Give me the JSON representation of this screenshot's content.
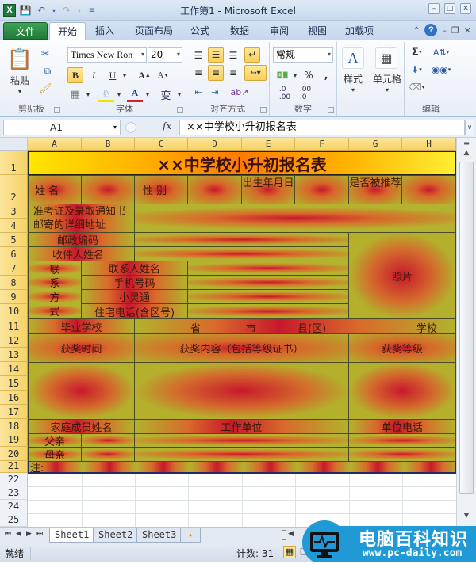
{
  "window": {
    "title": "工作簿1 - Microsoft Excel",
    "controls": [
      "minimize",
      "restore",
      "close"
    ]
  },
  "quick_access": [
    "excel-logo",
    "save",
    "undo",
    "redo",
    "customize"
  ],
  "ribbon_tabs": [
    {
      "label": "文件",
      "type": "file"
    },
    {
      "label": "开始",
      "active": true
    },
    {
      "label": "插入"
    },
    {
      "label": "页面布局"
    },
    {
      "label": "公式"
    },
    {
      "label": "数据"
    },
    {
      "label": "审阅"
    },
    {
      "label": "视图"
    },
    {
      "label": "加载项"
    }
  ],
  "ribbon": {
    "clipboard": {
      "label": "剪贴板",
      "paste": "粘贴"
    },
    "font": {
      "label": "字体",
      "font_name": "Times New Ron",
      "font_size": "20",
      "bold_active": true
    },
    "alignment": {
      "label": "对齐方式"
    },
    "number": {
      "label": "数字",
      "format": "常规",
      "percent": "%",
      "comma": ","
    },
    "styles": {
      "label": "样式"
    },
    "cells": {
      "label": "单元格"
    },
    "editing": {
      "label": "编辑"
    }
  },
  "formula_bar": {
    "name_box": "A1",
    "fx": "fx",
    "content": "××中学校小升初报名表"
  },
  "columns": [
    "A",
    "B",
    "C",
    "D",
    "E",
    "F",
    "G",
    "H"
  ],
  "rows": [
    "1",
    "2",
    "3",
    "4",
    "5",
    "6",
    "7",
    "8",
    "9",
    "10",
    "11",
    "12",
    "13",
    "14",
    "15",
    "16",
    "17",
    "18",
    "19",
    "20",
    "21",
    "22",
    "23",
    "24",
    "25"
  ],
  "form": {
    "title": "××中学校小升初报名表",
    "name_label": "姓  名",
    "gender_label": "性  别",
    "birth_label": "出生年月日",
    "recommend_label": "是否被推荐",
    "address_label": "准考证及录取通知书邮寄的详细地址",
    "postcode_label": "邮政编码",
    "recipient_label": "收件人姓名",
    "contact_group": [
      "联",
      "系",
      "方",
      "式"
    ],
    "contact_name_label": "联系人姓名",
    "mobile_label": "手机号码",
    "phs_label": "小灵通",
    "home_phone_label": "住宅电话(含区号)",
    "photo_label": "照片",
    "school_label": "毕业学校",
    "province": "省",
    "city": "市",
    "county": "县(区)",
    "school_suffix": "学校",
    "award_time_label": "获奖时间",
    "award_content_label": "获奖内容（包括等级证书）",
    "award_level_label": "获奖等级",
    "family_name_label": "家庭成员姓名",
    "work_unit_label": "工作单位",
    "unit_phone_label": "单位电话",
    "father": "父亲",
    "mother": "母亲",
    "note": "注:"
  },
  "sheets": [
    {
      "label": "Sheet1",
      "active": true
    },
    {
      "label": "Sheet2"
    },
    {
      "label": "Sheet3"
    }
  ],
  "status": {
    "ready": "就绪",
    "count": "计数: 31"
  },
  "watermark": {
    "text": "电脑百科知识",
    "url": "www.pc-daily.com"
  }
}
